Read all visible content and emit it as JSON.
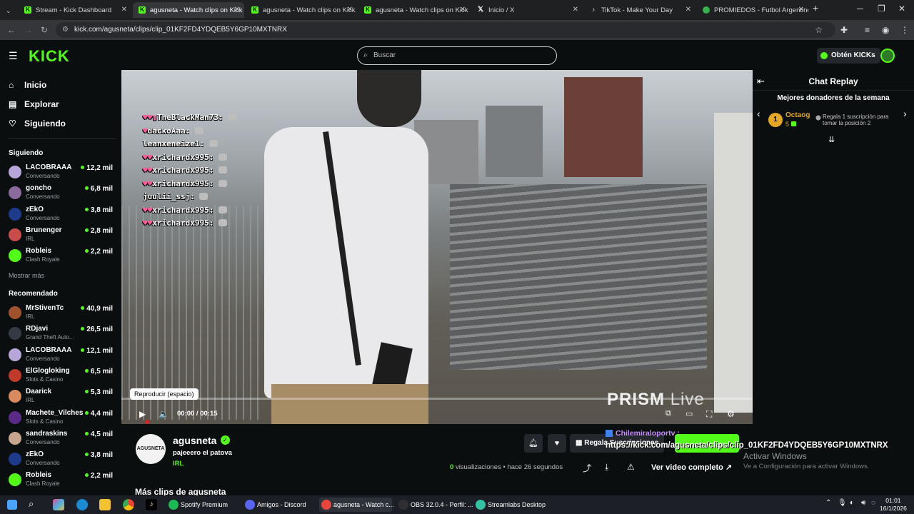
{
  "browser": {
    "tabs": [
      {
        "label": "Stream - Kick Dashboard",
        "icon": "kick-icon",
        "color": "#53fc18"
      },
      {
        "label": "agusneta - Watch clips on Kick",
        "icon": "kick-icon",
        "color": "#53fc18",
        "active": true
      },
      {
        "label": "agusneta - Watch clips on Kick",
        "icon": "kick-icon",
        "color": "#53fc18"
      },
      {
        "label": "agusneta - Watch clips on Kick",
        "icon": "kick-icon",
        "color": "#53fc18"
      },
      {
        "label": "Inicio / X",
        "icon": "x-icon",
        "color": "#ffffff"
      },
      {
        "label": "TikTok - Make Your Day",
        "icon": "tiktok-icon",
        "color": "#ffffff"
      },
      {
        "label": "PROMIEDOS - Futbol Argentino",
        "icon": "promiedos-icon",
        "color": "#36b34a"
      }
    ],
    "url": "kick.com/agusneta/clips/clip_01KF2FD4YDQEB5Y6GP10MXTNRX"
  },
  "header": {
    "logo": "KICK",
    "search_placeholder": "Buscar",
    "obten_label": "Obtén KICKs"
  },
  "sidebar": {
    "nav": [
      {
        "label": "Inicio",
        "icon": "home-icon"
      },
      {
        "label": "Explorar",
        "icon": "browse-icon"
      },
      {
        "label": "Siguiendo",
        "icon": "heart-icon"
      }
    ],
    "following_title": "Siguiendo",
    "following": [
      {
        "name": "LACOBRAAA",
        "category": "Conversando",
        "viewers": "12,2 mil",
        "color": "#b9a6d8"
      },
      {
        "name": "goncho",
        "category": "Conversando",
        "viewers": "6,8 mil",
        "color": "#8b6a9e"
      },
      {
        "name": "zEkO",
        "category": "Conversando",
        "viewers": "3,8 mil",
        "color": "#1e3a8a"
      },
      {
        "name": "Brunenger",
        "category": "IRL",
        "viewers": "2,8 mil",
        "color": "#c94c4c"
      },
      {
        "name": "Robleis",
        "category": "Clash Royale",
        "viewers": "2,2 mil",
        "color": "#53fc18"
      }
    ],
    "show_more": "Mostrar más",
    "recommended_title": "Recomendado",
    "recommended": [
      {
        "name": "MrStivenTc",
        "category": "IRL",
        "viewers": "40,9 mil",
        "color": "#a0522d"
      },
      {
        "name": "RDjavi",
        "category": "Grand Theft Auto...",
        "viewers": "26,5 mil",
        "color": "#333a44"
      },
      {
        "name": "LACOBRAAA",
        "category": "Conversando",
        "viewers": "12,1 mil",
        "color": "#b9a6d8"
      },
      {
        "name": "ElGlogloking",
        "category": "Slots & Casino",
        "viewers": "6,5 mil",
        "color": "#c0392b"
      },
      {
        "name": "Daarick",
        "category": "IRL",
        "viewers": "5,3 mil",
        "color": "#d98b5f"
      },
      {
        "name": "Machete_Vilches",
        "category": "Slots & Casino",
        "viewers": "4,4 mil",
        "color": "#5b2a86"
      },
      {
        "name": "sandraskins",
        "category": "Conversando",
        "viewers": "4,5 mil",
        "color": "#c7a48c"
      },
      {
        "name": "zEkO",
        "category": "Conversando",
        "viewers": "3,8 mil",
        "color": "#1e3a8a"
      },
      {
        "name": "Robleis",
        "category": "Clash Royale",
        "viewers": "2,2 mil",
        "color": "#53fc18"
      }
    ]
  },
  "video": {
    "overlay_chat": [
      {
        "user": "TheBlackMan73:",
        "badges": "♥♥▮"
      },
      {
        "user": "dackoAaa:",
        "badges": "♥"
      },
      {
        "user": "leanxeneize1:",
        "badges": ""
      },
      {
        "user": "xrichardx995:",
        "badges": "♥♥"
      },
      {
        "user": "xrichardx995:",
        "badges": "♥♥"
      },
      {
        "user": "xrichardx995:",
        "badges": "♥♥"
      },
      {
        "user": "juulii_ssj:",
        "badges": ""
      },
      {
        "user": "xrichardx995:",
        "badges": "♥♥"
      },
      {
        "user": "xrichardx995:",
        "badges": "♥♥"
      }
    ],
    "watermark": "PRISM",
    "watermark_live": "Live",
    "tooltip": "Reproducir (espacio)",
    "time": "00:00 / 00:15",
    "progress": 0
  },
  "chat": {
    "title": "Chat Replay",
    "donors_title": "Mejores donadores de la semana",
    "top_donor": {
      "rank": "1",
      "name": "Octaog",
      "count": "5"
    },
    "promo": "Regala 1 suscripción para tomar la posición 2"
  },
  "channel": {
    "name": "agusneta",
    "avatar_text": "AGUSNETA",
    "clip_title": "pajeeero el patova",
    "category": "IRL",
    "gift_label": "Regala Suscripciones",
    "views_count": "0",
    "views_label": "visualizaciones",
    "time_ago": "• hace 26 segundos",
    "full_video": "Ver video completo",
    "more_clips": "Más clips de agusneta"
  },
  "floating_chat": {
    "name": "Chilemiraloportv :",
    "message": "https://kick.com/agusneta/clips/clip_01KF2FD4YDQEB5Y6GP10MXTNRX"
  },
  "windows_activation": {
    "title": "Activar Windows",
    "subtitle": "Ve a Configuración para activar Windows."
  },
  "taskbar": {
    "apps": [
      {
        "label": "Spotify Premium",
        "color": "#1db954"
      },
      {
        "label": "Amigos - Discord",
        "color": "#5865f2"
      },
      {
        "label": "agusneta - Watch c...",
        "color": "#e8453c",
        "active": true
      },
      {
        "label": "OBS 32.0.4 - Perfil: ...",
        "color": "#302e31"
      },
      {
        "label": "Streamlabs Desktop",
        "color": "#31c3a2"
      }
    ],
    "time": "01:01",
    "date": "16/1/2026"
  }
}
